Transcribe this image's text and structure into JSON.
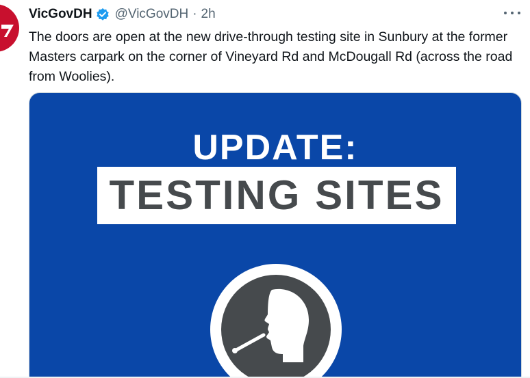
{
  "tweet": {
    "display_name": "VicGovDH",
    "handle": "@VicGovDH",
    "separator": "·",
    "time": "2h",
    "text": "The doors are open at the new drive-through testing site in Sunbury at the former Masters carpark on the corner of Vineyard Rd and McDougall Rd (across the road from Woolies)."
  },
  "media": {
    "heading": "UPDATE:",
    "banner": "TESTING SITES",
    "icon": "swab-test-head-icon"
  },
  "icons": {
    "avatar": "vicgov-logo-icon",
    "verified": "verified-badge-icon",
    "more": "more-options-icon"
  },
  "colors": {
    "media_background": "#0a47a8",
    "banner_text": "#464a4d",
    "verified": "#1d9bf0",
    "avatar": "#c8102e"
  }
}
